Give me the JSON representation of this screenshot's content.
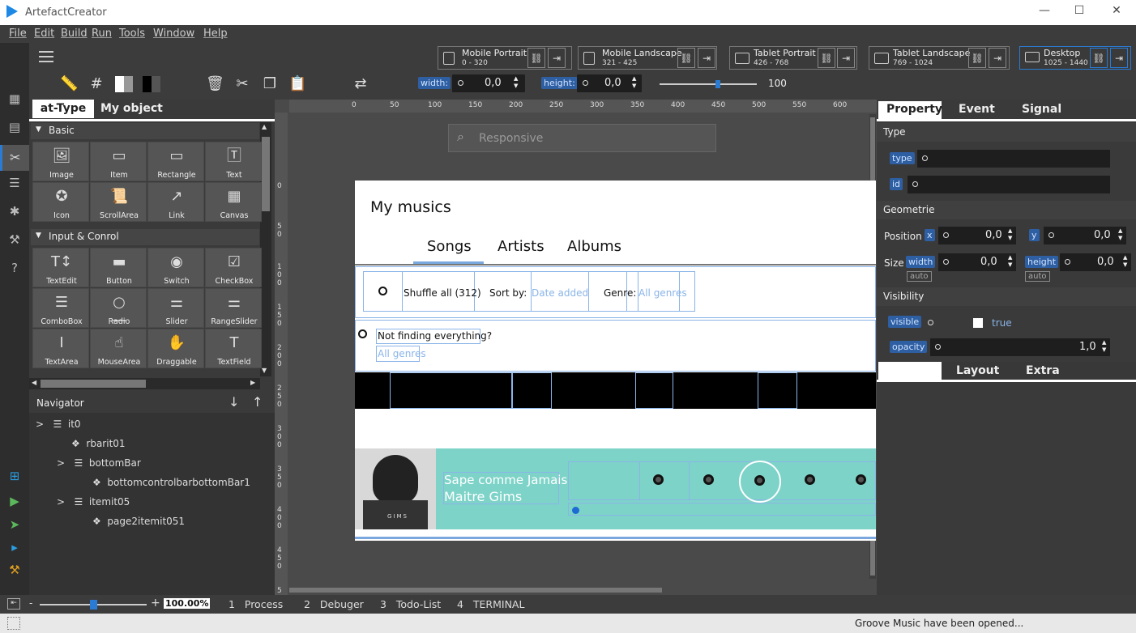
{
  "app": {
    "title": "ArtefactCreator",
    "min": "—",
    "max": "☐",
    "close": "✕"
  },
  "menu": [
    "File",
    "Edit",
    "Build",
    "Run",
    "Tools",
    "Window",
    "Help"
  ],
  "devices": [
    {
      "name": "Mobile Portrait",
      "range": "0 - 320",
      "active": false
    },
    {
      "name": "Mobile Landscape",
      "range": "321 - 425",
      "active": false
    },
    {
      "name": "Tablet Portrait",
      "range": "426 - 768",
      "active": false
    },
    {
      "name": "Tablet Landscape",
      "range": "769 - 1024",
      "active": false
    },
    {
      "name": "Desktop",
      "range": "1025 - 1440",
      "active": true
    }
  ],
  "toolbar": {
    "width_label": "width:",
    "width_value": "0,0",
    "height_label": "height:",
    "height_value": "0,0",
    "zoom_value": "100",
    "zoom_fraction": 0.6
  },
  "left_tabs": [
    "at-Type",
    "My object"
  ],
  "sections": [
    {
      "title": "Basic",
      "items": [
        "Image",
        "Item",
        "Rectangle",
        "Text",
        "Icon",
        "ScrollArea",
        "Link",
        "Canvas"
      ]
    },
    {
      "title": "Input & Conrol",
      "items": [
        "TextEdit",
        "Button",
        "Switch",
        "CheckBox",
        "ComboBox",
        "Radio",
        "Slider",
        "RangeSlider",
        "TextArea",
        "MouseArea",
        "Draggable",
        "TextField"
      ]
    }
  ],
  "navigator": {
    "title": "Navigator",
    "items": [
      "it0",
      "rbarit01",
      "bottomBar",
      "bottomcontrolbarbottomBar1",
      "itemit05",
      "page2itemit051"
    ]
  },
  "ruler": {
    "h": [
      "0",
      "50",
      "100",
      "150",
      "200",
      "250",
      "300",
      "350",
      "400",
      "450",
      "500",
      "550",
      "600"
    ],
    "v": [
      "0",
      "50",
      "100",
      "150",
      "200",
      "250",
      "300",
      "350",
      "400",
      "450",
      "500"
    ]
  },
  "design": {
    "search_placeholder": "Responsive",
    "title": "My musics",
    "tabs": [
      "Songs",
      "Artists",
      "Albums"
    ],
    "shuffle": "Shuffle all (312)",
    "sort_label": "Sort by:",
    "sort_value": "Date added",
    "genre_label": "Genre:",
    "genre_value": "All genres",
    "notfinding": "Not finding everything?",
    "all_genres": "All genres",
    "song": "Sape comme Jamais",
    "artist": "Maitre Gims",
    "album_text": "GIMS"
  },
  "right_tabs": [
    "Property",
    "Event",
    "Signal"
  ],
  "props": {
    "type_section": "Type",
    "type_label": "type",
    "id_label": "id",
    "geometry_section": "Geometrie",
    "position_label": "Position",
    "x_label": "x",
    "x_value": "0,0",
    "y_label": "y",
    "y_value": "0,0",
    "size_label": "Size",
    "width_label": "width",
    "width_value": "0,0",
    "height_label": "height",
    "height_value": "0,0",
    "auto": "auto",
    "visibility_section": "Visibility",
    "visible_label": "visible",
    "visible_value": "true",
    "opacity_label": "opacity",
    "opacity_value": "1,0",
    "tabs2": [
      "Layout",
      "Extra"
    ]
  },
  "bottom": {
    "zoom": "100.00%",
    "zoom_fraction": 0.5,
    "panels": [
      {
        "num": "1",
        "label": "Process"
      },
      {
        "num": "2",
        "label": "Debuger"
      },
      {
        "num": "3",
        "label": "Todo-List"
      },
      {
        "num": "4",
        "label": "TERMINAL"
      }
    ]
  },
  "status": "Groove Music have been opened...",
  "colors": {
    "accent": "#2a7bd4",
    "teal": "#7dd3c8",
    "label_blue": "#2f5fa3"
  }
}
